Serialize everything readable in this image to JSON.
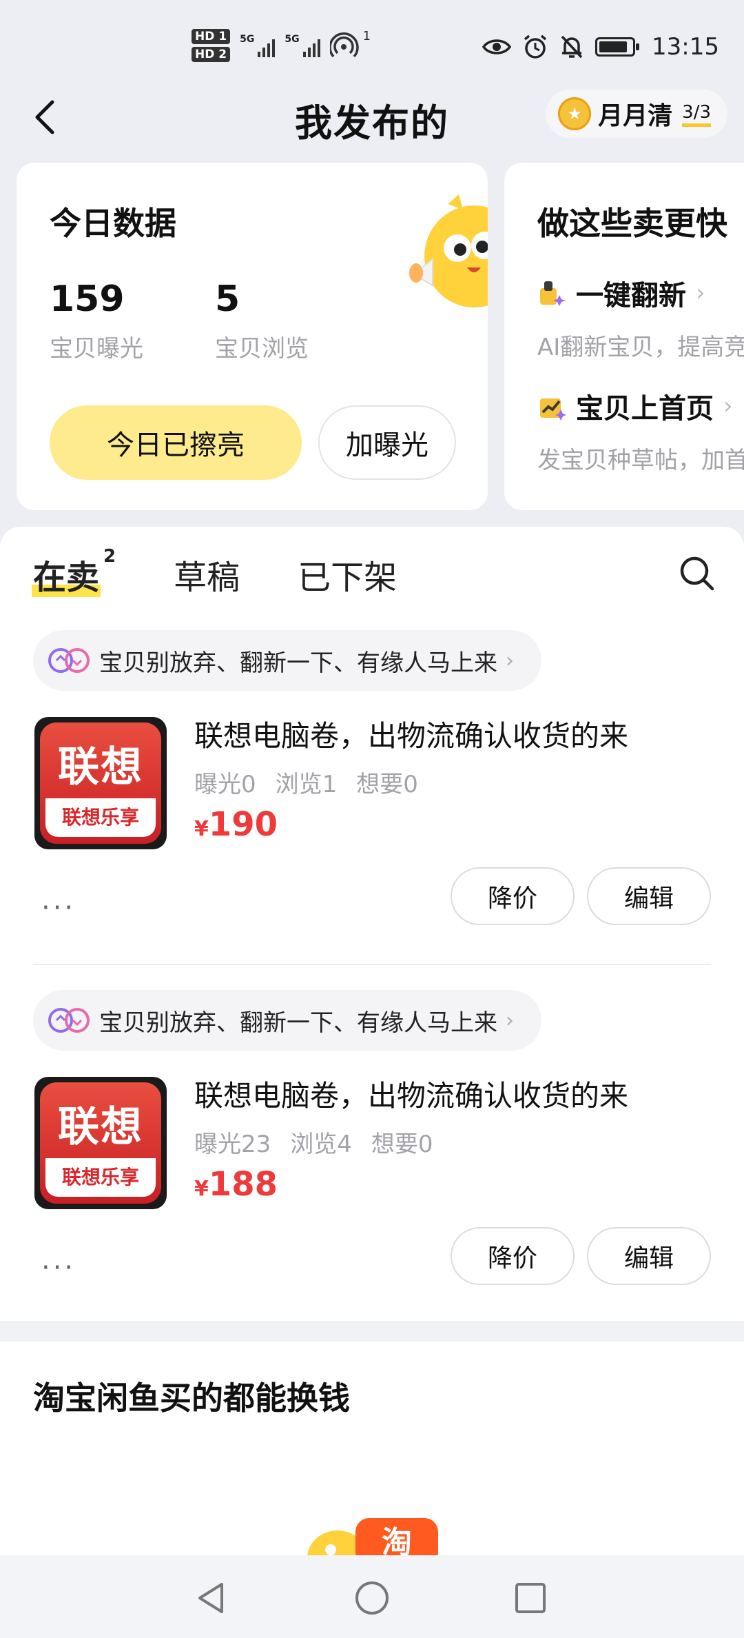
{
  "status_bar": {
    "hd1": "HD 1",
    "hd2": "HD 2",
    "net1": "5G",
    "net2": "5G",
    "hotspot_count": "1",
    "time": "13:15"
  },
  "header": {
    "title": "我发布的",
    "badge_label": "月月清",
    "badge_count": "3/3"
  },
  "today_card": {
    "title": "今日数据",
    "stats": [
      {
        "value": "159",
        "label": "宝贝曝光"
      },
      {
        "value": "5",
        "label": "宝贝浏览"
      }
    ],
    "polished_button": "今日已擦亮",
    "boost_button": "加曝光"
  },
  "faster_card": {
    "title": "做这些卖更快",
    "tips": [
      {
        "title": "一键翻新",
        "arrow": "›",
        "desc": "AI翻新宝贝，提高竞"
      },
      {
        "title": "宝贝上首页",
        "arrow": "›",
        "desc": "发宝贝种草帖，加首"
      }
    ]
  },
  "tabs": [
    {
      "label": "在卖",
      "badge": "2"
    },
    {
      "label": "草稿"
    },
    {
      "label": "已下架"
    }
  ],
  "items": [
    {
      "tip": "宝贝别放弃、翻新一下、有缘人马上来",
      "tip_arrow": "›",
      "thumb_brand": "联想",
      "thumb_sub": "联想乐享",
      "title": "联想电脑卷，出物流确认收货的来",
      "stats": [
        "曝光0",
        "浏览1",
        "想要0"
      ],
      "currency": "¥",
      "price": "190",
      "more": "···",
      "price_cut_button": "降价",
      "edit_button": "编辑"
    },
    {
      "tip": "宝贝别放弃、翻新一下、有缘人马上来",
      "tip_arrow": "›",
      "thumb_brand": "联想",
      "thumb_sub": "联想乐享",
      "title": "联想电脑卷，出物流确认收货的来",
      "stats": [
        "曝光23",
        "浏览4",
        "想要0"
      ],
      "currency": "¥",
      "price": "188",
      "more": "···",
      "price_cut_button": "降价",
      "edit_button": "编辑"
    }
  ],
  "promo": {
    "title": "淘宝闲鱼买的都能换钱",
    "art_glyph": "淘"
  },
  "icons": [
    "eye-icon",
    "alarm-icon",
    "mute-icon",
    "battery-icon",
    "back-icon",
    "search-icon",
    "coin-icon",
    "renew-icon",
    "trend-icon",
    "swap-icon",
    "nav-back-icon",
    "nav-home-icon",
    "nav-recent-icon"
  ],
  "colors": {
    "accent_yellow": "#ffe34a",
    "price_red": "#ee3a3a",
    "pill_bg": "#f4f4f7"
  }
}
